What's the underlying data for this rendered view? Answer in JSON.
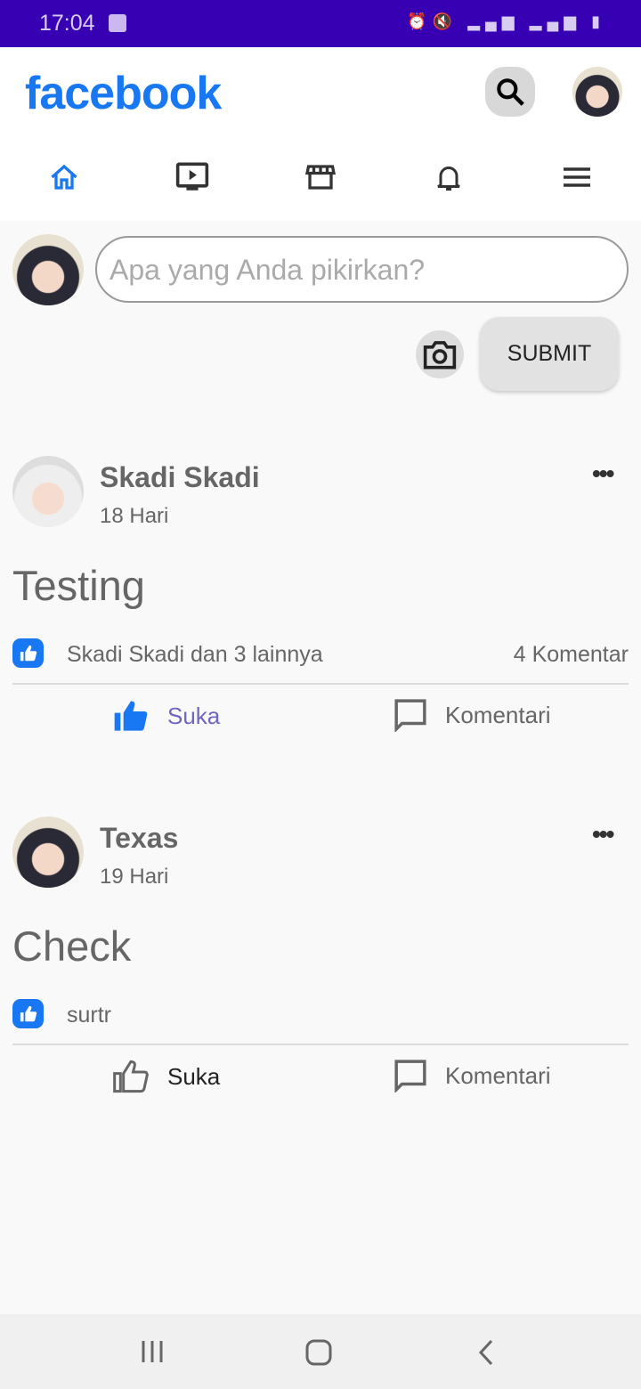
{
  "status_bar": {
    "time": "17:04",
    "icons": [
      "wifi-icon",
      "alarm-icon",
      "mute-icon",
      "4g-icon",
      "signal-icon",
      "signal-icon",
      "battery-icon"
    ]
  },
  "header": {
    "logo": "facebook",
    "brand_color": "#1877f2"
  },
  "nav": [
    "home",
    "watch",
    "marketplace",
    "notifications",
    "menu"
  ],
  "composer": {
    "placeholder": "Apa yang Anda pikirkan?",
    "submit": "SUBMIT"
  },
  "posts": [
    {
      "author": "Skadi Skadi",
      "time": "18 Hari",
      "text": "Testing",
      "likers": "Skadi Skadi dan 3 lainnya",
      "comments": "4 Komentar",
      "like_label": "Suka",
      "comment_label": "Komentari",
      "liked": true
    },
    {
      "author": "Texas",
      "time": "19 Hari",
      "text": "Check",
      "likers": "surtr",
      "comments": "",
      "like_label": "Suka",
      "comment_label": "Komentari",
      "liked": false
    }
  ]
}
